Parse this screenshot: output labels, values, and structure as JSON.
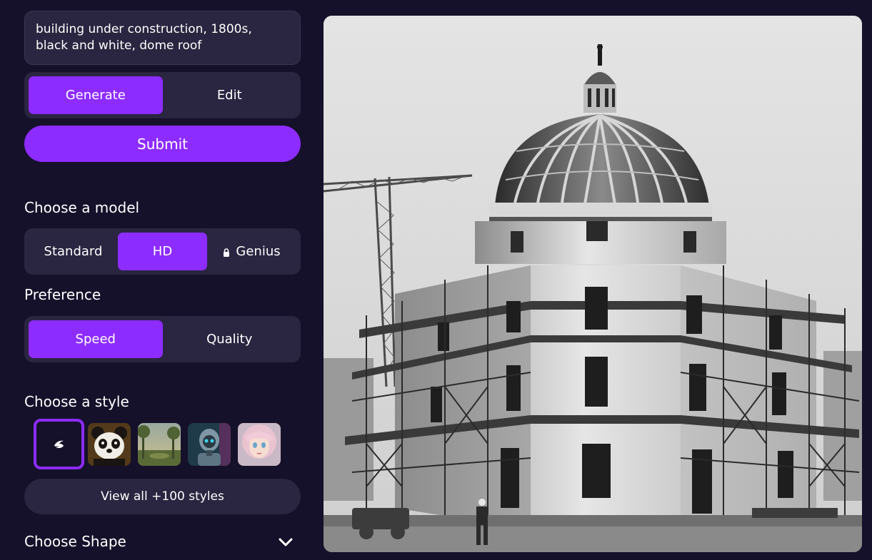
{
  "prompt": {
    "value": "building under construction, 1800s,\nblack and white, dome roof"
  },
  "mode": {
    "options": [
      "Generate",
      "Edit"
    ],
    "selected": "Generate"
  },
  "submit_label": "Submit",
  "model": {
    "title": "Choose a model",
    "options": [
      "Standard",
      "HD",
      "Genius"
    ],
    "selected": "HD",
    "locked": [
      "Genius"
    ]
  },
  "preference": {
    "title": "Preference",
    "options": [
      "Speed",
      "Quality"
    ],
    "selected": "Speed"
  },
  "style": {
    "title": "Choose a style",
    "thumbnails": [
      "no-style-icon",
      "panda",
      "forest-landscape",
      "cyborg-robot",
      "anime-girl"
    ],
    "selected": "no-style-icon",
    "view_all_label": "View all +100 styles"
  },
  "shape": {
    "title": "Choose Shape",
    "icon": "chevron-down-icon"
  },
  "result_image": {
    "description_icon": "generated-image"
  },
  "colors": {
    "accent": "#8d2cff",
    "background": "#15112a",
    "surface": "#2a2540"
  }
}
